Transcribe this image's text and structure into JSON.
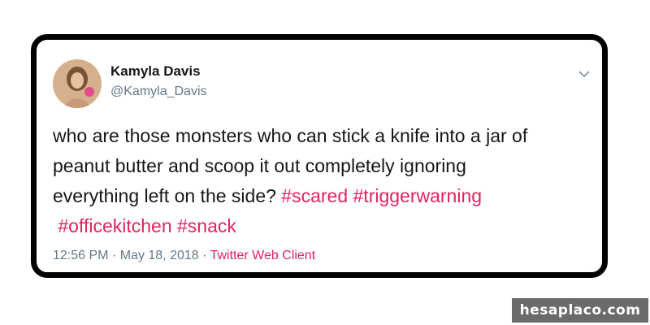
{
  "tweet": {
    "display_name": "Kamyla Davis",
    "handle": "@Kamyla_Davis",
    "menu_icon": "chevron-down-icon",
    "text_lines": [
      {
        "plain": "who are those monsters who can stick a knife into a jar of"
      },
      {
        "plain": "peanut butter and scoop it out completely ignoring"
      },
      {
        "plain": "everything left on the side? ",
        "hashtags": [
          "#scared",
          "#triggerwarning"
        ]
      },
      {
        "hashtags": [
          "#officekitchen",
          "#snack"
        ]
      }
    ],
    "hashtags": [
      "#scared",
      "#triggerwarning",
      "#officekitchen",
      "#snack"
    ],
    "time": "12:56 PM",
    "separator": "·",
    "date": "May 18, 2018",
    "source": "Twitter Web Client"
  },
  "watermark": "hesaplaco.com",
  "colors": {
    "text": "#14171a",
    "secondary": "#657786",
    "link": "#e0245e",
    "card_border": "#000000",
    "watermark_bg": "#6b6b6b"
  }
}
